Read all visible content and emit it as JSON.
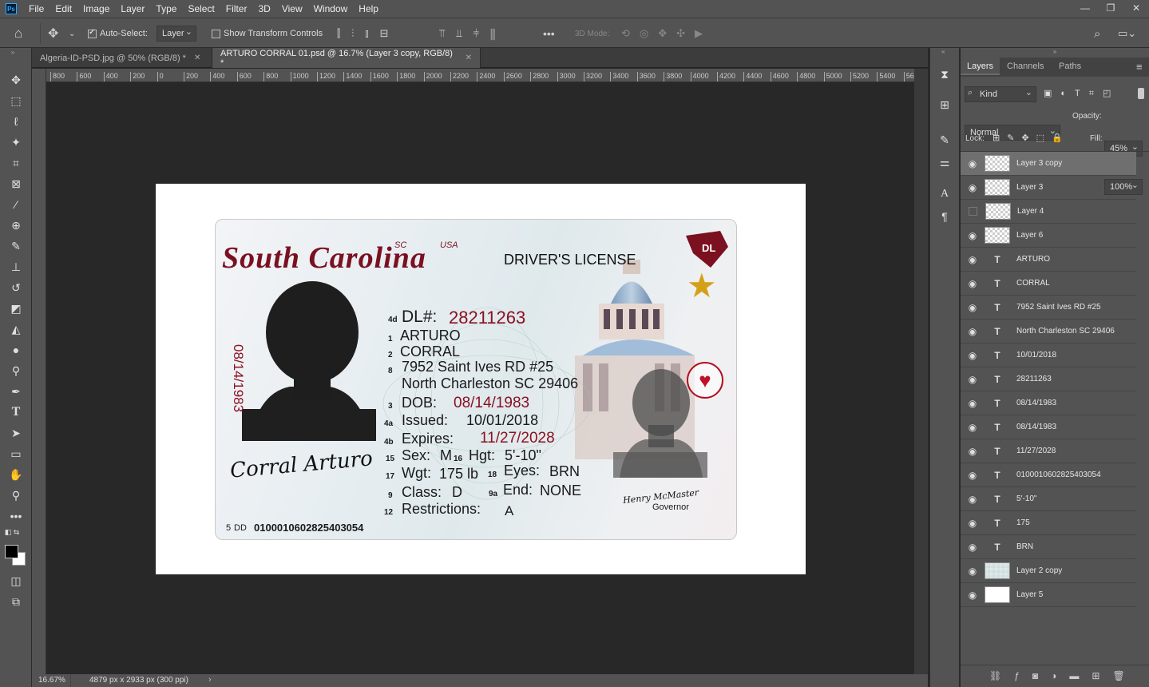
{
  "menubar": {
    "logo": "Ps",
    "items": [
      "File",
      "Edit",
      "Image",
      "Layer",
      "Type",
      "Select",
      "Filter",
      "3D",
      "View",
      "Window",
      "Help"
    ],
    "window_controls": [
      "—",
      "❐",
      "✕"
    ]
  },
  "options_bar": {
    "auto_select_label": "Auto-Select:",
    "auto_select_value": "Layer",
    "show_transform_label": "Show Transform Controls",
    "mode_3d_label": "3D Mode:"
  },
  "tabs": [
    {
      "label": "Algeria-ID-PSD.jpg @ 50% (RGB/8) *",
      "active": false
    },
    {
      "label": "ARTURO CORRAL 01.psd @ 16.7% (Layer 3 copy, RGB/8) *",
      "active": true
    }
  ],
  "ruler_ticks": [
    "800",
    "600",
    "400",
    "200",
    "0",
    "200",
    "400",
    "600",
    "800",
    "1000",
    "1200",
    "1400",
    "1600",
    "1800",
    "2000",
    "2200",
    "2400",
    "2600",
    "2800",
    "3000",
    "3200",
    "3400",
    "3600",
    "3800",
    "4000",
    "4200",
    "4400",
    "4600",
    "4800",
    "5000",
    "5200",
    "5400",
    "560"
  ],
  "status": {
    "zoom": "16.67%",
    "doc_info": "4879 px x 2933 px (300 ppi)"
  },
  "layers_panel": {
    "tabs": [
      "Layers",
      "Channels",
      "Paths"
    ],
    "filter_kind": "Kind",
    "blend_mode": "Normal",
    "opacity_label": "Opacity:",
    "opacity_value": "45%",
    "lock_label": "Lock:",
    "fill_label": "Fill:",
    "fill_value": "100%",
    "layers": [
      {
        "name": "Layer 3 copy",
        "type": "pixel",
        "visible": true,
        "active": true
      },
      {
        "name": "Layer 3",
        "type": "pixel",
        "visible": true,
        "active": false
      },
      {
        "name": "Layer 4",
        "type": "pixel",
        "visible": false,
        "active": false
      },
      {
        "name": "Layer 6",
        "type": "pixel",
        "visible": true,
        "active": false
      },
      {
        "name": "ARTURO",
        "type": "text",
        "visible": true,
        "active": false
      },
      {
        "name": "CORRAL",
        "type": "text",
        "visible": true,
        "active": false
      },
      {
        "name": "7952 Saint Ives RD #25",
        "type": "text",
        "visible": true,
        "active": false
      },
      {
        "name": "North Charleston SC 29406",
        "type": "text",
        "visible": true,
        "active": false
      },
      {
        "name": "10/01/2018",
        "type": "text",
        "visible": true,
        "active": false
      },
      {
        "name": "28211263",
        "type": "text",
        "visible": true,
        "active": false
      },
      {
        "name": "08/14/1983",
        "type": "text",
        "visible": true,
        "active": false
      },
      {
        "name": "08/14/1983",
        "type": "text",
        "visible": true,
        "active": false
      },
      {
        "name": "11/27/2028",
        "type": "text",
        "visible": true,
        "active": false
      },
      {
        "name": "0100010602825403054",
        "type": "text",
        "visible": true,
        "active": false
      },
      {
        "name": "5'-10\"",
        "type": "text",
        "visible": true,
        "active": false
      },
      {
        "name": "175",
        "type": "text",
        "visible": true,
        "active": false
      },
      {
        "name": "BRN",
        "type": "text",
        "visible": true,
        "active": false
      },
      {
        "name": "Layer 2 copy",
        "type": "card",
        "visible": true,
        "active": false
      },
      {
        "name": "Layer 5",
        "type": "white",
        "visible": true,
        "active": false
      }
    ]
  },
  "id_card": {
    "state": "South Carolina",
    "sc_small": "SC",
    "usa_small": "USA",
    "doc_type": "DRIVER'S LICENSE",
    "dl_badge": "DL",
    "dl_label_num": "4d",
    "dl_label": "DL#:",
    "dl_number": "28211263",
    "first_name_num": "1",
    "first_name": "ARTURO",
    "last_name_num": "2",
    "last_name": "CORRAL",
    "address_num": "8",
    "address_line1": "7952 Saint Ives RD #25",
    "address_line2": "North Charleston SC 29406",
    "dob_num": "3",
    "dob_label": "DOB:",
    "dob": "08/14/1983",
    "issued_num": "4a",
    "issued_label": "Issued:",
    "issued": "10/01/2018",
    "expires_num": "4b",
    "expires_label": "Expires:",
    "expires": "11/27/2028",
    "sex_num": "15",
    "sex_label": "Sex:",
    "sex": "M",
    "hgt_num": "16",
    "hgt_label": "Hgt:",
    "height": "5'-10\"",
    "wgt_num": "17",
    "wgt_label": "Wgt:",
    "weight": "175 lb",
    "eyes_num": "18",
    "eyes_label": "Eyes:",
    "eyes": "BRN",
    "class_num": "9",
    "class_label": "Class:",
    "class": "D",
    "end_num": "9a",
    "end_label": "End:",
    "endorsements": "NONE",
    "restr_num": "12",
    "restr_label": "Restrictions:",
    "restrictions": "A",
    "dd_num": "5",
    "dd_label": "DD",
    "dd": "0100010602825403054",
    "vertical_dob": "08/14/1983",
    "signature": "Corral Arturo",
    "governor_label": "Governor",
    "governor_signature": "Henry McMaster"
  },
  "colors": {
    "ui_dark": "#535353",
    "canvas_bg": "#282828",
    "accent_red": "#7a1020",
    "dl_value_red": "#8b1022",
    "star_gold": "#d4a017"
  }
}
